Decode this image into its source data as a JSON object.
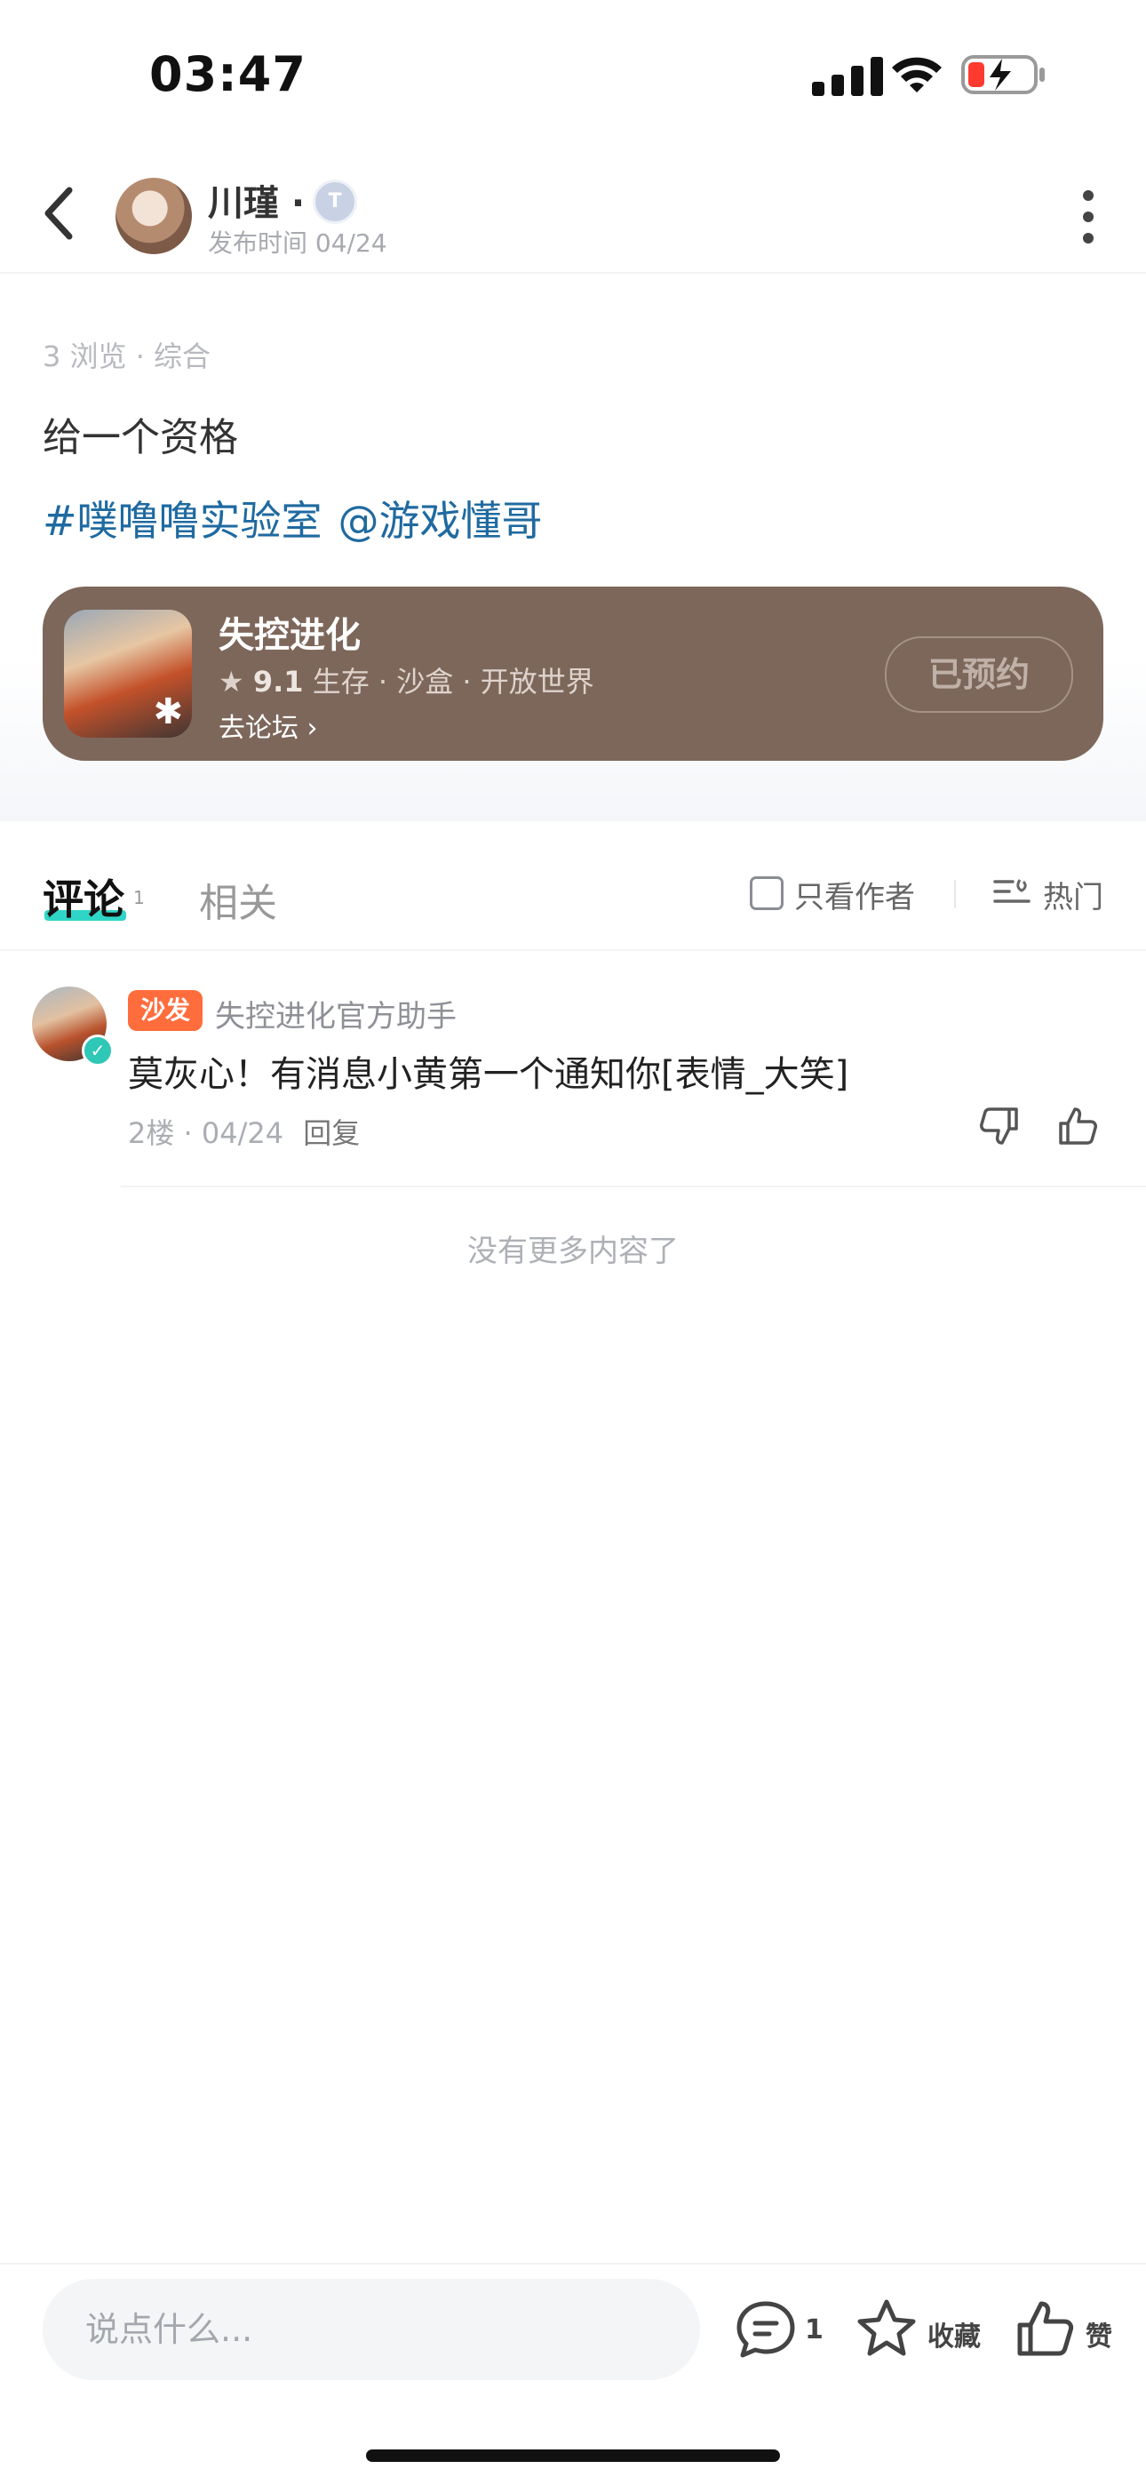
{
  "status_bar": {
    "time": "03:47"
  },
  "header": {
    "author_name": "川瑾 ·",
    "badge_letter": "T",
    "publish_time": "发布时间 04/24"
  },
  "post": {
    "meta": "3 浏览 · 综合",
    "body": "给一个资格",
    "tags": [
      "#噗噜噜实验室",
      "@游戏懂哥"
    ]
  },
  "game_card": {
    "name": "失控进化",
    "rating": "9.1",
    "genres": "生存 · 沙盒 · 开放世界",
    "forum_link": "去论坛",
    "action": "已预约"
  },
  "tabs": {
    "comments": "评论",
    "comments_count": "1",
    "related": "相关",
    "author_only": "只看作者",
    "sort": "热门"
  },
  "comments": [
    {
      "badge": "沙发",
      "user": "失控进化官方助手",
      "text": "莫灰心！有消息小黄第一个通知你[表情_大笑]",
      "floor_date": "2楼 · 04/24",
      "reply": "回复"
    }
  ],
  "no_more": "没有更多内容了",
  "bottom_bar": {
    "input_placeholder": "说点什么...",
    "comment_count": "1",
    "favorite_label": "收藏",
    "like_label": "赞"
  },
  "colors": {
    "accent": "#2fd6c7",
    "link": "#1f6aa0",
    "card_bg": "#7d675b",
    "sofa_badge": "#ff6d3d"
  }
}
